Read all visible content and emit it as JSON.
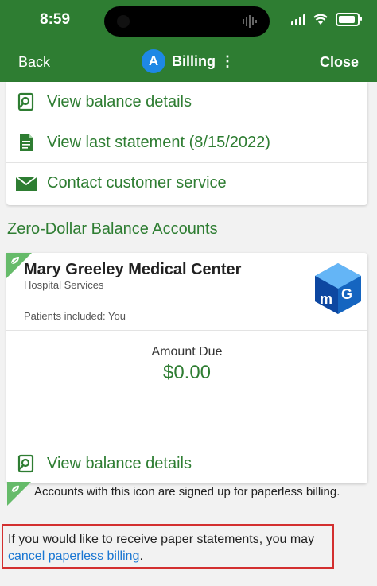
{
  "status_bar": {
    "time": "8:59"
  },
  "nav": {
    "back_label": "Back",
    "avatar_letter": "A",
    "title": "Billing",
    "menu_glyph": "⋮",
    "close_label": "Close"
  },
  "links": [
    {
      "label": "View balance details",
      "icon": "balance-search-icon"
    },
    {
      "label": "View last statement (8/15/2022)",
      "icon": "document-icon"
    },
    {
      "label": "Contact customer service",
      "icon": "envelope-icon"
    }
  ],
  "section_title": "Zero-Dollar Balance Accounts",
  "account": {
    "name": "Mary Greeley Medical Center",
    "type": "Hospital Services",
    "patients": "Patients included: You",
    "amount_label": "Amount Due",
    "amount_value": "$0.00",
    "link_label": "View balance details",
    "logo_icon": "mgmc-logo"
  },
  "legend_text": "Accounts with this icon are signed up for paperless billing.",
  "notice": {
    "text_before": "If you would like to receive paper statements, you may ",
    "link_text": "cancel paperless billing",
    "text_after": "."
  },
  "colors": {
    "brand_green": "#2e7d32",
    "link_blue": "#1976d2",
    "highlight_red": "#d32f2f"
  }
}
